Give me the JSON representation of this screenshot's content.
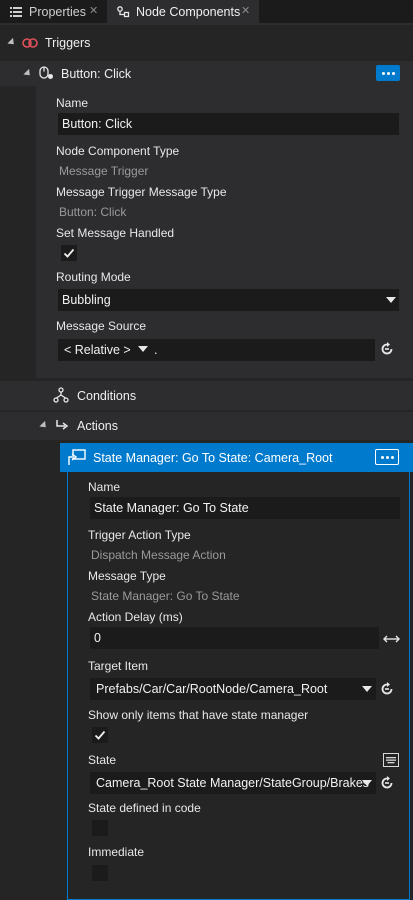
{
  "tabs": {
    "properties": "Properties",
    "node_components": "Node Components",
    "close_glyph": "✕"
  },
  "triggers": {
    "label": "Triggers"
  },
  "button_click": {
    "label": "Button: Click",
    "name_label": "Name",
    "name_value": "Button: Click",
    "type_label": "Node Component Type",
    "type_value": "Message Trigger",
    "msg_type_label": "Message Trigger Message Type",
    "msg_type_value": "Button: Click",
    "handled_label": "Set Message Handled",
    "handled_checked": true,
    "routing_label": "Routing Mode",
    "routing_value": "Bubbling",
    "source_label": "Message Source",
    "source_value": "< Relative >",
    "source_path": "."
  },
  "conditions": {
    "label": "Conditions"
  },
  "actions": {
    "label": "Actions"
  },
  "state_action": {
    "header": "State Manager: Go To State: Camera_Root",
    "name_label": "Name",
    "name_value": "State Manager: Go To State",
    "trigger_type_label": "Trigger Action Type",
    "trigger_type_value": "Dispatch Message Action",
    "msg_type_label": "Message Type",
    "msg_type_value": "State Manager: Go To State",
    "delay_label": "Action Delay (ms)",
    "delay_value": "0",
    "target_label": "Target Item",
    "target_value": "Prefabs/Car/Car/RootNode/Camera_Root",
    "show_only_label": "Show only items that have state manager",
    "show_only_checked": true,
    "state_label": "State",
    "state_value": "Camera_Root State Manager/StateGroup/Brakes",
    "in_code_label": "State defined in code",
    "in_code_checked": false,
    "immediate_label": "Immediate",
    "immediate_checked": false
  },
  "colors": {
    "accent": "#007acc",
    "selected_row": "#007acc",
    "panel_bg": "#252526",
    "field_bg": "#1b1b1c",
    "trigger_icon": "#e0505a"
  },
  "icons": {
    "properties_tab": "list-icon",
    "node_components_tab": "node-icon",
    "triggers": "trigger-icon",
    "button_click": "mouse-click-icon",
    "conditions": "branch-icon",
    "actions": "action-arrow-icon",
    "state_action": "monitor-flag-icon",
    "reset": "reset-arrow-icon",
    "expand": "expand-horizontal-icon",
    "state_picker": "keyboard-icon"
  }
}
